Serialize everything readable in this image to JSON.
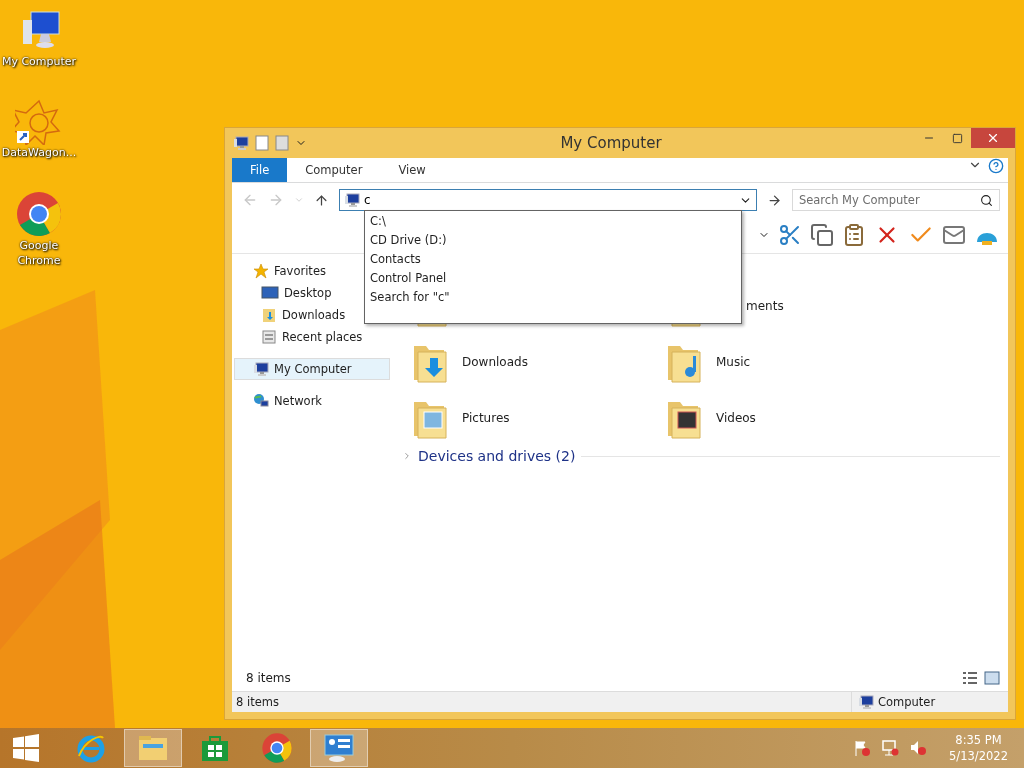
{
  "desktop_icons": [
    {
      "kind": "computer",
      "label": "My Computer"
    },
    {
      "kind": "datawagon",
      "label": "DataWagon..."
    },
    {
      "kind": "chrome",
      "label": "Google Chrome"
    }
  ],
  "window": {
    "title": "My Computer",
    "ribbon_tabs": [
      {
        "kind": "file",
        "label": "File"
      },
      {
        "kind": "tab",
        "label": "Computer"
      },
      {
        "kind": "tab",
        "label": "View"
      }
    ],
    "address": {
      "value": "c"
    },
    "search": {
      "placeholder": "Search My Computer"
    },
    "autocomplete": [
      "C:\\",
      "CD Drive (D:)",
      "Contacts",
      "Control Panel",
      "Search for \"c\""
    ],
    "nav": [
      {
        "kind": "star",
        "label": "Favorites",
        "selected": false,
        "children": [
          {
            "kind": "desktop",
            "label": "Desktop",
            "selected": false
          },
          {
            "kind": "downloads",
            "label": "Downloads",
            "selected": false
          },
          {
            "kind": "recent",
            "label": "Recent places",
            "selected": false
          }
        ]
      },
      {
        "kind": "computer",
        "label": "My Computer",
        "selected": true
      },
      {
        "kind": "network",
        "label": "Network",
        "selected": false
      }
    ],
    "folders": [
      {
        "kind": "desktop"
      },
      {
        "kind": "documents",
        "label": "ments",
        "clipped": true
      },
      {
        "kind": "downloads",
        "label": "Downloads"
      },
      {
        "kind": "music",
        "label": "Music"
      },
      {
        "kind": "pictures",
        "label": "Pictures"
      },
      {
        "kind": "videos",
        "label": "Videos"
      }
    ],
    "section": {
      "label": "Devices and drives (2)",
      "expanded": false
    },
    "content_status": "8 items",
    "status_bar": {
      "left": "8 items",
      "right": "Computer"
    }
  },
  "taskbar": {
    "apps": [
      {
        "kind": "ie",
        "selected": false
      },
      {
        "kind": "explorer",
        "selected": true
      },
      {
        "kind": "store",
        "selected": false
      },
      {
        "kind": "chrome",
        "selected": false
      },
      {
        "kind": "remote",
        "selected": true
      }
    ],
    "time": "8:35 PM",
    "date": "5/13/2022"
  }
}
